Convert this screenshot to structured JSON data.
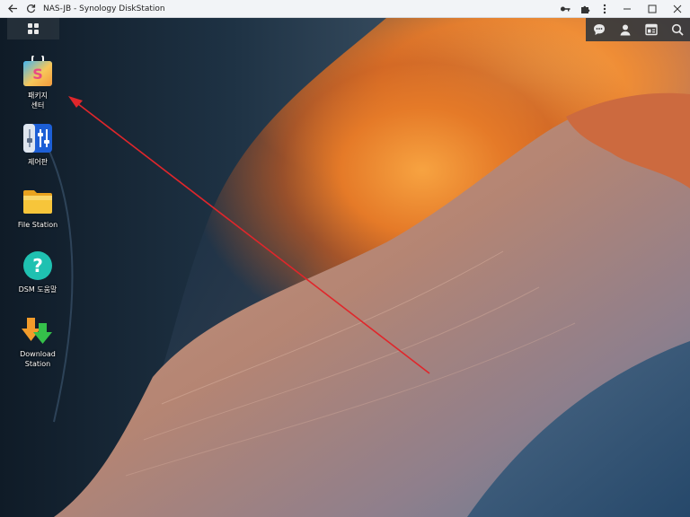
{
  "window": {
    "title": "NAS-JB - Synology DiskStation"
  },
  "desktop_icons": [
    {
      "label": "패키지\n센터",
      "icon": "package-center-icon"
    },
    {
      "label": "제어판",
      "icon": "control-panel-icon"
    },
    {
      "label": "File Station",
      "icon": "folder-icon"
    },
    {
      "label": "DSM 도움말",
      "icon": "help-icon"
    },
    {
      "label": "Download Station",
      "icon": "download-icon"
    }
  ],
  "colors": {
    "annotation_arrow": "#e0262b",
    "taskbar_bg": "#28323c"
  }
}
